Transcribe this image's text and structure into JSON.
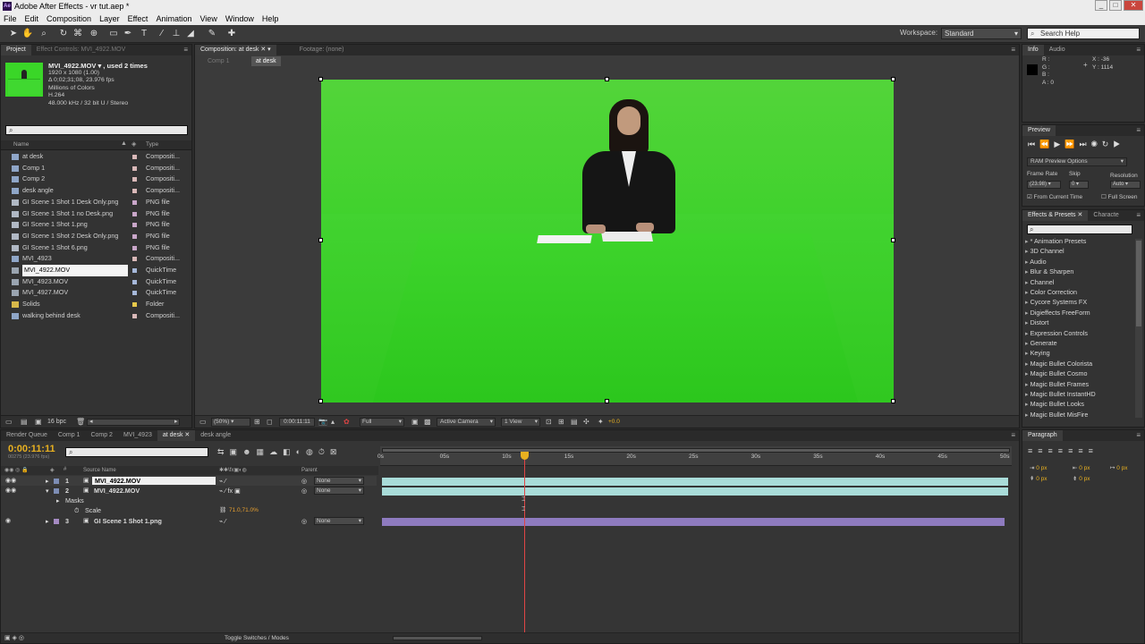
{
  "window": {
    "title": "Adobe After Effects - vr tut.aep *",
    "minimize": "_",
    "maximize": "□",
    "close": "✕"
  },
  "menu": [
    "File",
    "Edit",
    "Composition",
    "Layer",
    "Effect",
    "Animation",
    "View",
    "Window",
    "Help"
  ],
  "toolbar": {
    "workspace_label": "Workspace:",
    "workspace_value": "Standard",
    "search_placeholder": "Search Help"
  },
  "project": {
    "tab": "Project",
    "effect_controls_tab": "Effect Controls: MVI_4922.MOV",
    "selected_name": "MVI_4922.MOV ▾ , used 2 times",
    "info_lines": [
      "1920 x 1080 (1.00)",
      "Δ 0;02;31;08, 23.976 fps",
      "Millions of Colors",
      "H.264",
      "48.000 kHz / 32 bit U / Stereo"
    ],
    "search_placeholder": "",
    "col_name": "Name",
    "col_type": "Type",
    "items": [
      {
        "name": "at desk",
        "type": "Compositi...",
        "swatch": "#d9b8b8",
        "kind": "comp"
      },
      {
        "name": "Comp 1",
        "type": "Compositi...",
        "swatch": "#d9b8b8",
        "kind": "comp"
      },
      {
        "name": "Comp 2",
        "type": "Compositi...",
        "swatch": "#d9b8b8",
        "kind": "comp"
      },
      {
        "name": "desk angle",
        "type": "Compositi...",
        "swatch": "#d9b8b8",
        "kind": "comp"
      },
      {
        "name": "GI Scene 1 Shot 1 Desk Only.png",
        "type": "PNG file",
        "swatch": "#c9a6c9",
        "kind": "img"
      },
      {
        "name": "GI Scene 1 Shot 1 no Desk.png",
        "type": "PNG file",
        "swatch": "#c9a6c9",
        "kind": "img"
      },
      {
        "name": "GI Scene 1 Shot 1.png",
        "type": "PNG file",
        "swatch": "#c9a6c9",
        "kind": "img"
      },
      {
        "name": "GI Scene 1 Shot 2 Desk Only.png",
        "type": "PNG file",
        "swatch": "#c9a6c9",
        "kind": "img"
      },
      {
        "name": "GI Scene 1 Shot 6.png",
        "type": "PNG file",
        "swatch": "#c9a6c9",
        "kind": "img"
      },
      {
        "name": "MVI_4923",
        "type": "Compositi...",
        "swatch": "#d9b8b8",
        "kind": "comp"
      },
      {
        "name": "MVI_4922.MOV",
        "type": "QuickTime",
        "swatch": "#a6b8d9",
        "kind": "mov",
        "selected": true
      },
      {
        "name": "MVI_4923.MOV",
        "type": "QuickTime",
        "swatch": "#a6b8d9",
        "kind": "mov"
      },
      {
        "name": "MVI_4927.MOV",
        "type": "QuickTime",
        "swatch": "#a6b8d9",
        "kind": "mov"
      },
      {
        "name": "Solids",
        "type": "Folder",
        "swatch": "#e6c84a",
        "kind": "folder"
      },
      {
        "name": "walking behind desk",
        "type": "Compositi...",
        "swatch": "#d9b8b8",
        "kind": "comp"
      }
    ],
    "bpc": "16 bpc"
  },
  "composition": {
    "tab": "Composition: at desk",
    "footage_tab": "Footage: (none)",
    "breadcrumb_prev": "Comp 1",
    "breadcrumb_current": "at desk",
    "zoom": "(50%)",
    "timecode": "0:00:11:11",
    "resolution": "Full",
    "camera": "Active Camera",
    "view": "1 View",
    "exposure": "+0.0"
  },
  "info_panel": {
    "tab": "Info",
    "audio_tab": "Audio",
    "r": "R :",
    "g": "G :",
    "b": "B :",
    "a": "A : 0",
    "x": "X : -36",
    "y": "Y : 1114"
  },
  "preview": {
    "tab": "Preview",
    "ram_options": "RAM Preview Options",
    "frame_rate_label": "Frame Rate",
    "skip_label": "Skip",
    "resolution_label": "Resolution",
    "frame_rate": "(23.98)",
    "skip": "0",
    "resolution": "Auto",
    "from_current": "From Current Time",
    "full_screen": "Full Screen"
  },
  "effects": {
    "tab": "Effects & Presets",
    "char_tab": "Characte",
    "items": [
      "* Animation Presets",
      "3D Channel",
      "Audio",
      "Blur & Sharpen",
      "Channel",
      "Color Correction",
      "Cycore Systems FX",
      "Digieffects FreeForm",
      "Distort",
      "Expression Controls",
      "Generate",
      "Keying",
      "Magic Bullet Colorista",
      "Magic Bullet Cosmo",
      "Magic Bullet Frames",
      "Magic Bullet InstantHD",
      "Magic Bullet Looks",
      "Magic Bullet MisFire"
    ]
  },
  "paragraph": {
    "tab": "Paragraph",
    "px1": "0 px",
    "px2": "0 px",
    "px3": "0 px",
    "px4": "0 px",
    "px5": "0 px"
  },
  "timeline": {
    "tabs": [
      "Render Queue",
      "Comp 1",
      "Comp 2",
      "MVI_4923",
      "at desk",
      "desk angle"
    ],
    "timecode": "0:00:11:11",
    "frames": "00275 (23.976 fps)",
    "col_source": "Source Name",
    "col_parent": "Parent",
    "ruler": [
      "0s",
      "05s",
      "10s",
      "15s",
      "20s",
      "25s",
      "30s",
      "35s",
      "40s",
      "45s",
      "50s"
    ],
    "layers": [
      {
        "num": "1",
        "name": "MVI_4922.MOV",
        "parent": "None",
        "color": "#7d8db5"
      },
      {
        "num": "2",
        "name": "MVI_4922.MOV",
        "parent": "None",
        "color": "#7d8db5"
      },
      {
        "num": "3",
        "name": "GI Scene 1 Shot 1.png",
        "parent": "None",
        "color": "#a58ac2"
      }
    ],
    "masks_label": "Masks",
    "scale_label": "Scale",
    "scale_value": "71.0,71.0%",
    "toggle_label": "Toggle Switches / Modes"
  },
  "colors": {
    "green_screen": "#3ad628",
    "bar_cyan": "#a9dcd9",
    "bar_purple": "#8e7bbf",
    "playhead": "#e04545",
    "timecode": "#e8b020"
  }
}
